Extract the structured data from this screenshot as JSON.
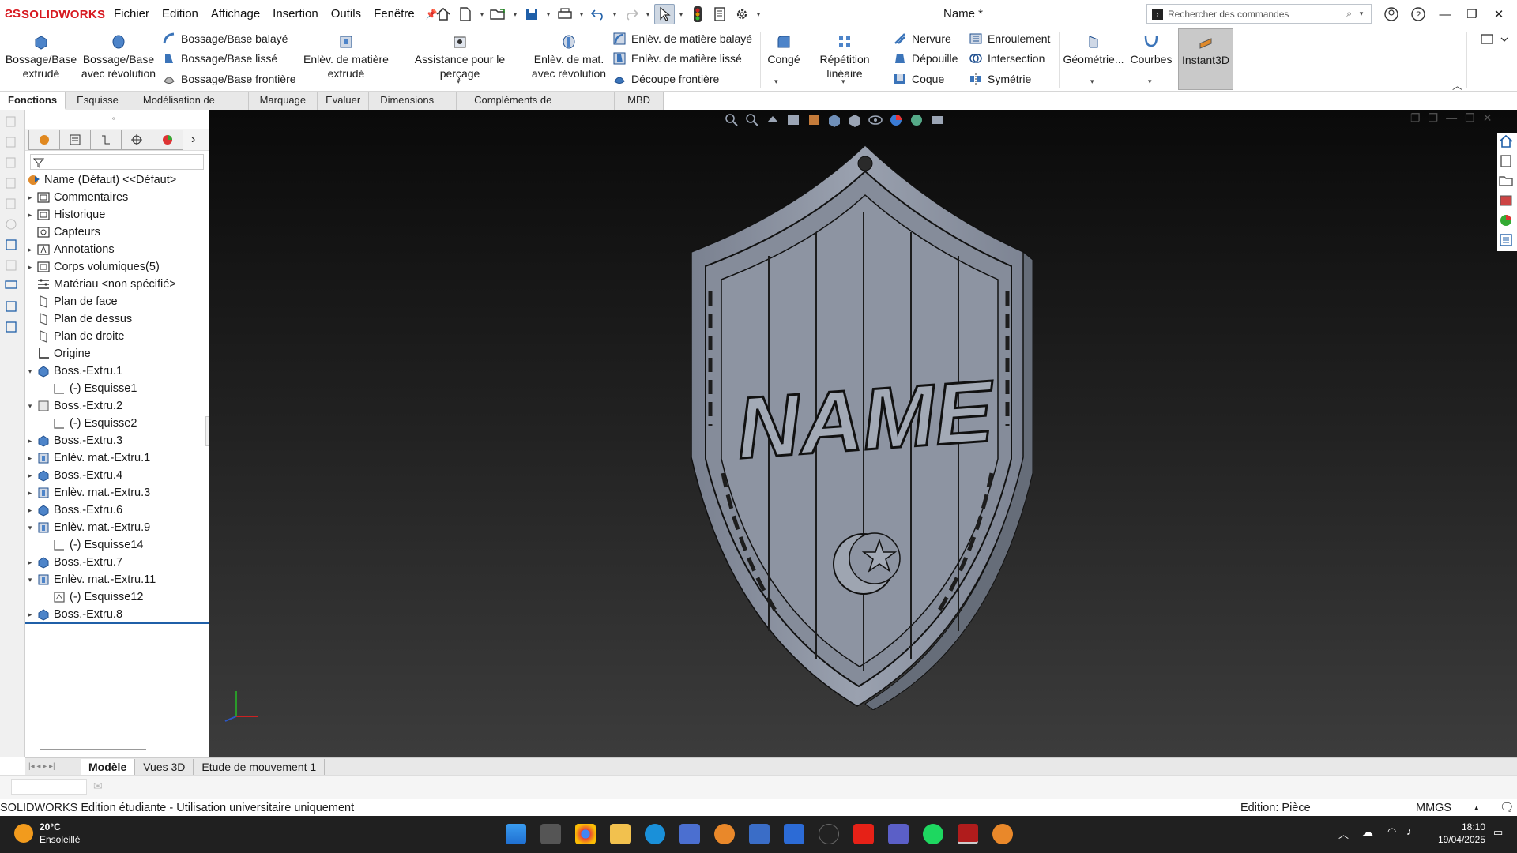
{
  "app": {
    "logo_text": "SOLIDWORKS",
    "doc_title": "Name *",
    "search_placeholder": "Rechercher des commandes"
  },
  "menu": [
    "Fichier",
    "Edition",
    "Affichage",
    "Insertion",
    "Outils",
    "Fenêtre"
  ],
  "ribbon": {
    "bossage_extrude": "Bossage/Base extrudé",
    "bossage_revolution": "Bossage/Base avec révolution",
    "bossage_balaye": "Bossage/Base balayé",
    "bossage_lisse": "Bossage/Base lissé",
    "bossage_frontiere": "Bossage/Base frontière",
    "enlev_extrude": "Enlèv. de matière extrudé",
    "assistance_percage": "Assistance pour le perçage",
    "enlev_revolution": "Enlèv. de mat. avec révolution",
    "enlev_balaye": "Enlèv. de matière balayé",
    "enlev_lisse": "Enlèv. de matière lissé",
    "decoupe_frontiere": "Découpe frontière",
    "conge": "Congé",
    "repetition": "Répétition linéaire",
    "nervure": "Nervure",
    "depouille": "Dépouille",
    "coque": "Coque",
    "enroulement": "Enroulement",
    "intersection": "Intersection",
    "symetrie": "Symétrie",
    "geometrie": "Géométrie...",
    "courbes": "Courbes",
    "instant3d": "Instant3D"
  },
  "tabs": [
    "Fonctions",
    "Esquisse",
    "Modélisation de maillage",
    "Marquage",
    "Evaluer",
    "Dimensions MBD",
    "Compléments de SOLIDWORKS",
    "MBD"
  ],
  "tree": [
    {
      "label": "Name  (Défaut) <<Défaut>",
      "indent": 0,
      "toggle": "",
      "icon": "part"
    },
    {
      "label": "Commentaires",
      "indent": 1,
      "toggle": "▸",
      "icon": "folder"
    },
    {
      "label": "Historique",
      "indent": 1,
      "toggle": "▸",
      "icon": "folder"
    },
    {
      "label": "Capteurs",
      "indent": 1,
      "toggle": "",
      "icon": "sensor"
    },
    {
      "label": "Annotations",
      "indent": 1,
      "toggle": "▸",
      "icon": "annot"
    },
    {
      "label": "Corps volumiques(5)",
      "indent": 1,
      "toggle": "▸",
      "icon": "folder"
    },
    {
      "label": "Matériau <non spécifié>",
      "indent": 1,
      "toggle": "",
      "icon": "material"
    },
    {
      "label": "Plan de face",
      "indent": 1,
      "toggle": "",
      "icon": "plane"
    },
    {
      "label": "Plan de dessus",
      "indent": 1,
      "toggle": "",
      "icon": "plane"
    },
    {
      "label": "Plan de droite",
      "indent": 1,
      "toggle": "",
      "icon": "plane"
    },
    {
      "label": "Origine",
      "indent": 1,
      "toggle": "",
      "icon": "origin"
    },
    {
      "label": "Boss.-Extru.1",
      "indent": 1,
      "toggle": "▾",
      "icon": "boss"
    },
    {
      "label": "(-) Esquisse1",
      "indent": 2,
      "toggle": "",
      "icon": "sketch"
    },
    {
      "label": "Boss.-Extru.2",
      "indent": 1,
      "toggle": "▾",
      "icon": "boss2"
    },
    {
      "label": "(-) Esquisse2",
      "indent": 2,
      "toggle": "",
      "icon": "sketch"
    },
    {
      "label": "Boss.-Extru.3",
      "indent": 1,
      "toggle": "▸",
      "icon": "boss"
    },
    {
      "label": "Enlèv. mat.-Extru.1",
      "indent": 1,
      "toggle": "▸",
      "icon": "cut"
    },
    {
      "label": "Boss.-Extru.4",
      "indent": 1,
      "toggle": "▸",
      "icon": "boss"
    },
    {
      "label": "Enlèv. mat.-Extru.3",
      "indent": 1,
      "toggle": "▸",
      "icon": "cut"
    },
    {
      "label": "Boss.-Extru.6",
      "indent": 1,
      "toggle": "▸",
      "icon": "boss"
    },
    {
      "label": "Enlèv. mat.-Extru.9",
      "indent": 1,
      "toggle": "▾",
      "icon": "cut"
    },
    {
      "label": "(-) Esquisse14",
      "indent": 2,
      "toggle": "",
      "icon": "sketch"
    },
    {
      "label": "Boss.-Extru.7",
      "indent": 1,
      "toggle": "▸",
      "icon": "boss"
    },
    {
      "label": "Enlèv. mat.-Extru.11",
      "indent": 1,
      "toggle": "▾",
      "icon": "cut"
    },
    {
      "label": "(-) Esquisse12",
      "indent": 2,
      "toggle": "",
      "icon": "sketch2"
    },
    {
      "label": "Boss.-Extru.8",
      "indent": 1,
      "toggle": "▸",
      "icon": "boss"
    }
  ],
  "model": {
    "text": "NAME"
  },
  "bottom_tabs": [
    "Modèle",
    "Vues 3D",
    "Etude de mouvement 1"
  ],
  "status": {
    "left": "SOLIDWORKS Edition étudiante - Utilisation universitaire uniquement",
    "mode": "Edition: Pièce",
    "units": "MMGS"
  },
  "taskbar": {
    "temp": "20°C",
    "weather": "Ensoleillé",
    "time": "18:10",
    "date": "19/04/2025"
  },
  "colors": {
    "brand": "#d71920",
    "accent": "#1f5fa8",
    "model": "#8c93a2"
  }
}
